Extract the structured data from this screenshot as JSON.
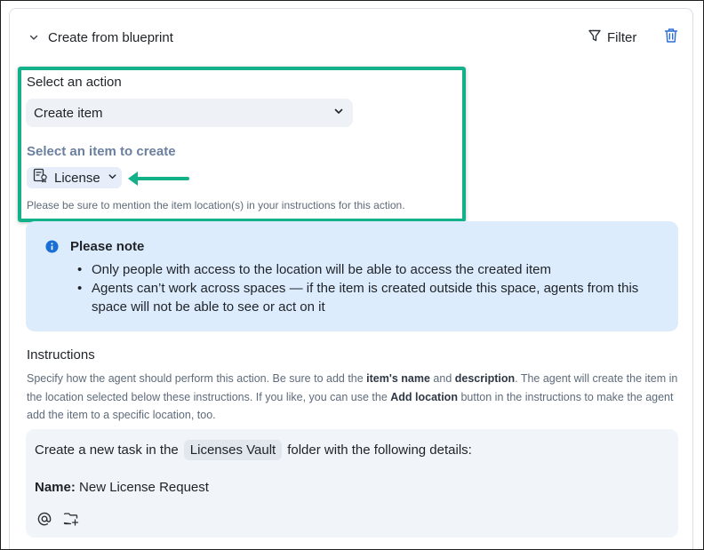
{
  "header": {
    "title": "Create from blueprint",
    "filter_label": "Filter"
  },
  "action": {
    "label": "Select an action",
    "selected": "Create item"
  },
  "item": {
    "label": "Select an item to create",
    "selected": "License",
    "hint": "Please be sure to mention the item location(s) in your instructions for this action."
  },
  "note": {
    "title": "Please note",
    "items": [
      "Only people with access to the location will be able to access the created item",
      "Agents can’t work across spaces — if the item is created outside this space, agents from this space will not be able to see or act on it"
    ]
  },
  "instructions": {
    "title": "Instructions",
    "desc_1": "Specify how the agent should perform this action. Be sure to add the ",
    "desc_b1": "item's name",
    "desc_2": " and ",
    "desc_b2": "description",
    "desc_3": ". The agent will create the item in the location selected below these instructions. If you like, you can use the ",
    "desc_b3": "Add location",
    "desc_4": " button in the instructions to make the agent add the item to a specific location, too."
  },
  "editor": {
    "line1_pre": "Create a new task in the",
    "folder": "Licenses Vault",
    "line1_post": "folder with the following details:",
    "name_label": "Name:",
    "name_value": " New License Request"
  },
  "colors": {
    "highlight": "#12b18a",
    "note_bg": "#dcecfd",
    "info_icon": "#1a6fd6",
    "accent_blue": "#2b6cd4"
  }
}
